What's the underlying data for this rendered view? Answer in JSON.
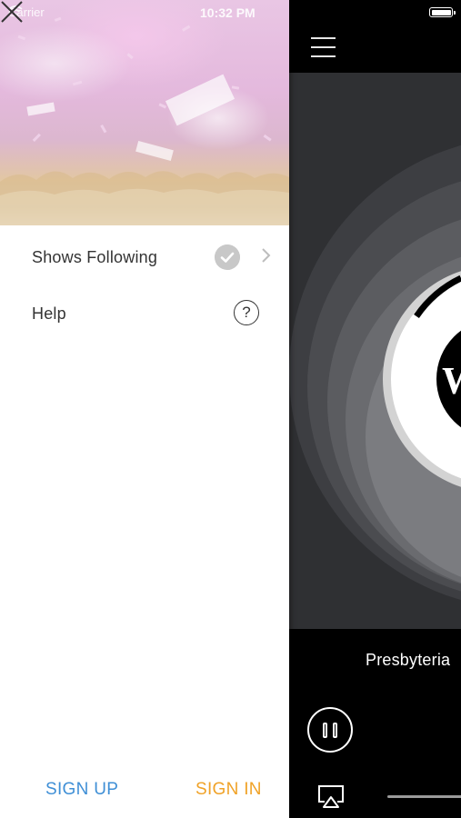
{
  "status_bar": {
    "carrier": "Carrier",
    "time": "10:32 PM"
  },
  "drawer": {
    "menu": [
      {
        "label": "Shows Following",
        "icon": "checkmark-circle-icon",
        "trailing_icon": "chevron-right-icon"
      },
      {
        "label": "Help",
        "icon": "question-circle-icon"
      }
    ],
    "sign_up_label": "SIGN UP",
    "sign_in_label": "SIGN IN",
    "colors": {
      "sign_up": "#3f8fd6",
      "sign_in": "#f0a227"
    }
  },
  "player": {
    "station_name": "Presbyteria",
    "logo_letter": "W",
    "play_state": "playing"
  }
}
